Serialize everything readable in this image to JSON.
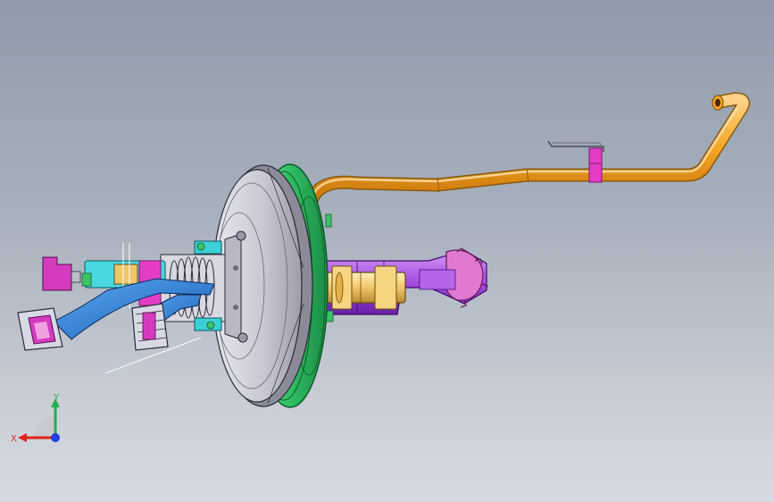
{
  "viewport": {
    "background_top": "#8f9aaa",
    "background_bottom": "#d7dae0"
  },
  "model": {
    "parts": [
      {
        "name": "brake-line-pipe",
        "color": "#f5a623"
      },
      {
        "name": "brake-booster",
        "color": "#c9c9d6"
      },
      {
        "name": "booster-seal-ring",
        "color": "#3cc36a"
      },
      {
        "name": "master-cylinder",
        "color": "#f0c66a"
      },
      {
        "name": "reservoir-housing",
        "color": "#a24de0"
      },
      {
        "name": "pedal-bracket",
        "color": "#2a7bd6"
      },
      {
        "name": "return-spring",
        "color": "#c8c8c8"
      },
      {
        "name": "mounting-clip",
        "color": "#e53cc8"
      }
    ]
  },
  "triad": {
    "x_label": "X",
    "y_label": "Y",
    "x_color": "#e0221c",
    "y_color": "#22b04a",
    "z_color": "#1f3fe0"
  }
}
